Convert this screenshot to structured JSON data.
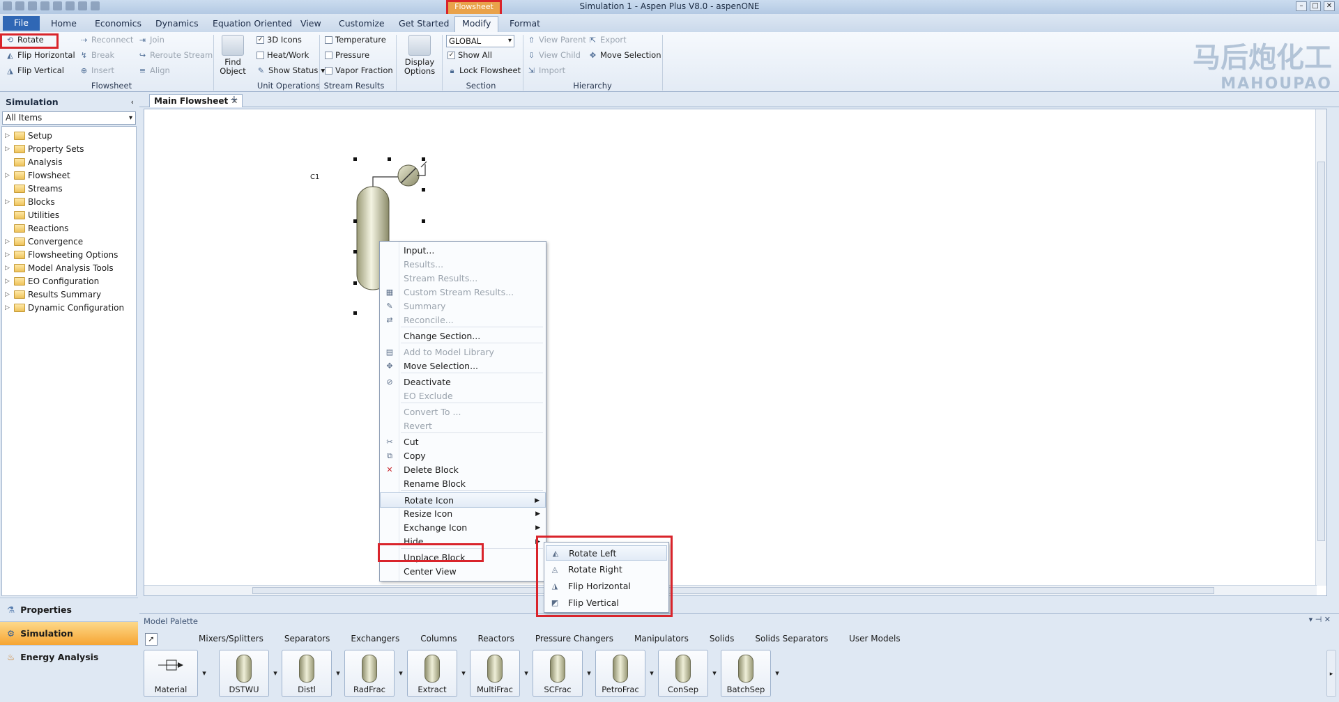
{
  "window": {
    "title": "Simulation 1 - Aspen Plus V8.0 - aspenONE",
    "context_tab": "Flowsheet"
  },
  "tabs": [
    "File",
    "Home",
    "Economics",
    "Dynamics",
    "Equation Oriented",
    "View",
    "Customize",
    "Get Started",
    "Modify",
    "Format"
  ],
  "ribbon": {
    "rotate": "Rotate",
    "flip_horizontal": "Flip Horizontal",
    "flip_vertical": "Flip Vertical",
    "reconnect": "Reconnect",
    "break": "Break",
    "insert": "Insert",
    "join": "Join",
    "reroute_stream": "Reroute Stream",
    "align": "Align",
    "flowsheet_group": "Flowsheet",
    "find_object": "Find Object",
    "icons_3d": "3D Icons",
    "heat_work": "Heat/Work",
    "show_status": "Show Status",
    "unit_operations_group": "Unit Operations",
    "temperature": "Temperature",
    "pressure": "Pressure",
    "vapor_fraction": "Vapor Fraction",
    "stream_results_group": "Stream Results",
    "display_options": "Display Options",
    "section_value": "GLOBAL",
    "show_all": "Show All",
    "lock_flowsheet": "Lock Flowsheet",
    "section_group": "Section",
    "view_parent": "View Parent",
    "view_child": "View Child",
    "import": "Import",
    "export": "Export",
    "move_selection": "Move Selection",
    "hierarchy_group": "Hierarchy"
  },
  "logo": {
    "cn": "马后炮化工",
    "en": "MAHOUPAO"
  },
  "sidebar": {
    "title": "Simulation",
    "filter": "All Items",
    "items": [
      {
        "label": "Setup",
        "expandable": true
      },
      {
        "label": "Property Sets",
        "expandable": true
      },
      {
        "label": "Analysis",
        "expandable": false
      },
      {
        "label": "Flowsheet",
        "expandable": true
      },
      {
        "label": "Streams",
        "expandable": false
      },
      {
        "label": "Blocks",
        "expandable": true
      },
      {
        "label": "Utilities",
        "expandable": false
      },
      {
        "label": "Reactions",
        "expandable": false
      },
      {
        "label": "Convergence",
        "expandable": true
      },
      {
        "label": "Flowsheeting Options",
        "expandable": true
      },
      {
        "label": "Model Analysis Tools",
        "expandable": true
      },
      {
        "label": "EO Configuration",
        "expandable": true
      },
      {
        "label": "Results Summary",
        "expandable": true
      },
      {
        "label": "Dynamic Configuration",
        "expandable": true
      }
    ],
    "nav": [
      "Properties",
      "Simulation",
      "Energy Analysis"
    ]
  },
  "document": {
    "tab": "Main Flowsheet",
    "block_label": "C1"
  },
  "context_menu": [
    {
      "label": "Input...",
      "enabled": true,
      "icon": ""
    },
    {
      "label": "Results...",
      "enabled": false,
      "icon": ""
    },
    {
      "label": "Stream Results...",
      "enabled": false,
      "icon": ""
    },
    {
      "label": "Custom Stream Results...",
      "enabled": false,
      "icon": "table-icon"
    },
    {
      "label": "Summary",
      "enabled": false,
      "icon": "summary-icon"
    },
    {
      "label": "Reconcile...",
      "enabled": false,
      "icon": "reconcile-icon"
    },
    {
      "label": "Change Section...",
      "enabled": true,
      "icon": ""
    },
    {
      "label": "Add to Model Library",
      "enabled": false,
      "icon": "library-icon"
    },
    {
      "label": "Move Selection...",
      "enabled": true,
      "icon": "move-icon"
    },
    {
      "label": "Deactivate",
      "enabled": true,
      "icon": "deactivate-icon"
    },
    {
      "label": "EO Exclude",
      "enabled": false,
      "icon": ""
    },
    {
      "label": "Convert To ...",
      "enabled": false,
      "icon": ""
    },
    {
      "label": "Revert",
      "enabled": false,
      "icon": ""
    },
    {
      "label": "Cut",
      "enabled": true,
      "icon": "cut-icon"
    },
    {
      "label": "Copy",
      "enabled": true,
      "icon": "copy-icon"
    },
    {
      "label": "Delete Block",
      "enabled": true,
      "icon": "delete-icon"
    },
    {
      "label": "Rename Block",
      "enabled": true,
      "icon": ""
    },
    {
      "label": "Rotate Icon",
      "enabled": true,
      "icon": ""
    },
    {
      "label": "Resize Icon",
      "enabled": true,
      "icon": ""
    },
    {
      "label": "Exchange Icon",
      "enabled": true,
      "icon": ""
    },
    {
      "label": "Hide",
      "enabled": true,
      "icon": ""
    },
    {
      "label": "Unplace Block",
      "enabled": true,
      "icon": ""
    },
    {
      "label": "Center View",
      "enabled": true,
      "icon": ""
    }
  ],
  "submenu": [
    "Rotate Left",
    "Rotate Right",
    "Flip Horizontal",
    "Flip Vertical"
  ],
  "palette": {
    "title": "Model Palette",
    "tabs": [
      "Mixers/Splitters",
      "Separators",
      "Exchangers",
      "Columns",
      "Reactors",
      "Pressure Changers",
      "Manipulators",
      "Solids",
      "Solids Separators",
      "User Models"
    ],
    "items": [
      "Material",
      "DSTWU",
      "Distl",
      "RadFrac",
      "Extract",
      "MultiFrac",
      "SCFrac",
      "PetroFrac",
      "ConSep",
      "BatchSep"
    ]
  }
}
